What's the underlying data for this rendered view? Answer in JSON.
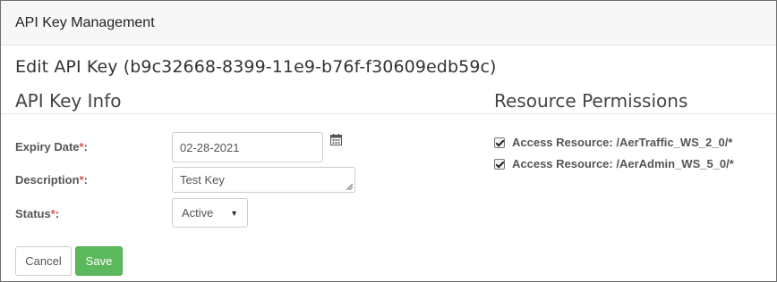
{
  "header": {
    "title": "API Key Management"
  },
  "page": {
    "edit_title": "Edit API Key (b9c32668-8399-11e9-b76f-f30609edb59c)"
  },
  "sections": {
    "info_title": "API Key Info",
    "permissions_title": "Resource Permissions"
  },
  "form": {
    "required_mark": "*",
    "expiry": {
      "label": "Expiry Date",
      "suffix": ":",
      "value": "02-28-2021"
    },
    "description": {
      "label": "Description",
      "suffix": ":",
      "value": "Test Key"
    },
    "status": {
      "label": "Status",
      "suffix": ":",
      "value": "Active"
    }
  },
  "permissions": [
    {
      "label": "Access Resource: /AerTraffic_WS_2_0/*",
      "checked": true
    },
    {
      "label": "Access Resource: /AerAdmin_WS_5_0/*",
      "checked": true
    }
  ],
  "buttons": {
    "cancel": "Cancel",
    "save": "Save"
  },
  "colors": {
    "required": "#d9534f",
    "save_bg": "#5cb85c",
    "topbar_bg": "#f7f7f7"
  },
  "icons": {
    "calendar": "calendar-icon",
    "select_caret": "caret-down-icon",
    "resize": "resize-handle-icon"
  }
}
